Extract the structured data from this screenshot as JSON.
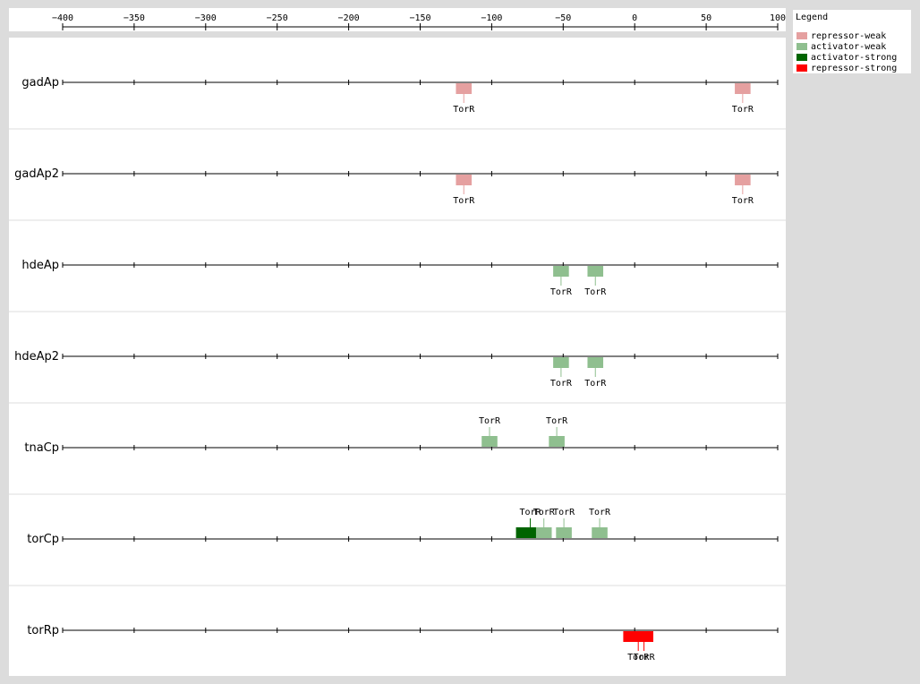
{
  "axis": {
    "min": -400,
    "max": 100,
    "ticks": [
      -400,
      -350,
      -300,
      -250,
      -200,
      -150,
      -100,
      -50,
      0,
      50,
      100
    ]
  },
  "legend": {
    "title": "Legend",
    "items": [
      {
        "label": "repressor-weak",
        "color": "#e5a0a0"
      },
      {
        "label": "activator-weak",
        "color": "#8fbf8f"
      },
      {
        "label": "activator-strong",
        "color": "#006400"
      },
      {
        "label": "repressor-strong",
        "color": "#ff0000"
      }
    ]
  },
  "promoters": [
    {
      "name": "gadAp",
      "sites": [
        {
          "label": "TorR",
          "type": "repressor-weak",
          "start": -125,
          "end": -114,
          "side": "below"
        },
        {
          "label": "TorR",
          "type": "repressor-weak",
          "start": 70,
          "end": 81,
          "side": "below"
        }
      ]
    },
    {
      "name": "gadAp2",
      "sites": [
        {
          "label": "TorR",
          "type": "repressor-weak",
          "start": -125,
          "end": -114,
          "side": "below"
        },
        {
          "label": "TorR",
          "type": "repressor-weak",
          "start": 70,
          "end": 81,
          "side": "below"
        }
      ]
    },
    {
      "name": "hdeAp",
      "sites": [
        {
          "label": "TorR",
          "type": "activator-weak",
          "start": -57,
          "end": -46,
          "side": "below"
        },
        {
          "label": "TorR",
          "type": "activator-weak",
          "start": -33,
          "end": -22,
          "side": "below"
        }
      ]
    },
    {
      "name": "hdeAp2",
      "sites": [
        {
          "label": "TorR",
          "type": "activator-weak",
          "start": -57,
          "end": -46,
          "side": "below"
        },
        {
          "label": "TorR",
          "type": "activator-weak",
          "start": -33,
          "end": -22,
          "side": "below"
        }
      ]
    },
    {
      "name": "tnaCp",
      "sites": [
        {
          "label": "TorR",
          "type": "activator-weak",
          "start": -107,
          "end": -96,
          "side": "above"
        },
        {
          "label": "TorR",
          "type": "activator-weak",
          "start": -60,
          "end": -49,
          "side": "above"
        }
      ]
    },
    {
      "name": "torCp",
      "sites": [
        {
          "label": "TorR",
          "type": "activator-strong",
          "start": -83,
          "end": -63,
          "side": "above"
        },
        {
          "label": "TorR",
          "type": "activator-weak",
          "start": -55,
          "end": -44,
          "side": "above"
        },
        {
          "label": "TorR",
          "type": "activator-weak",
          "start": -30,
          "end": -19,
          "side": "above"
        },
        {
          "label": "TorR",
          "type": "activator-weak",
          "start": -69,
          "end": -58,
          "side": "above"
        }
      ]
    },
    {
      "name": "torRp",
      "sites": [
        {
          "label": "TorR",
          "type": "repressor-strong",
          "start": -8,
          "end": 13,
          "side": "below"
        },
        {
          "label": "TorR",
          "type": "repressor-strong",
          "start": 0,
          "end": 13,
          "side": "below"
        }
      ]
    }
  ]
}
